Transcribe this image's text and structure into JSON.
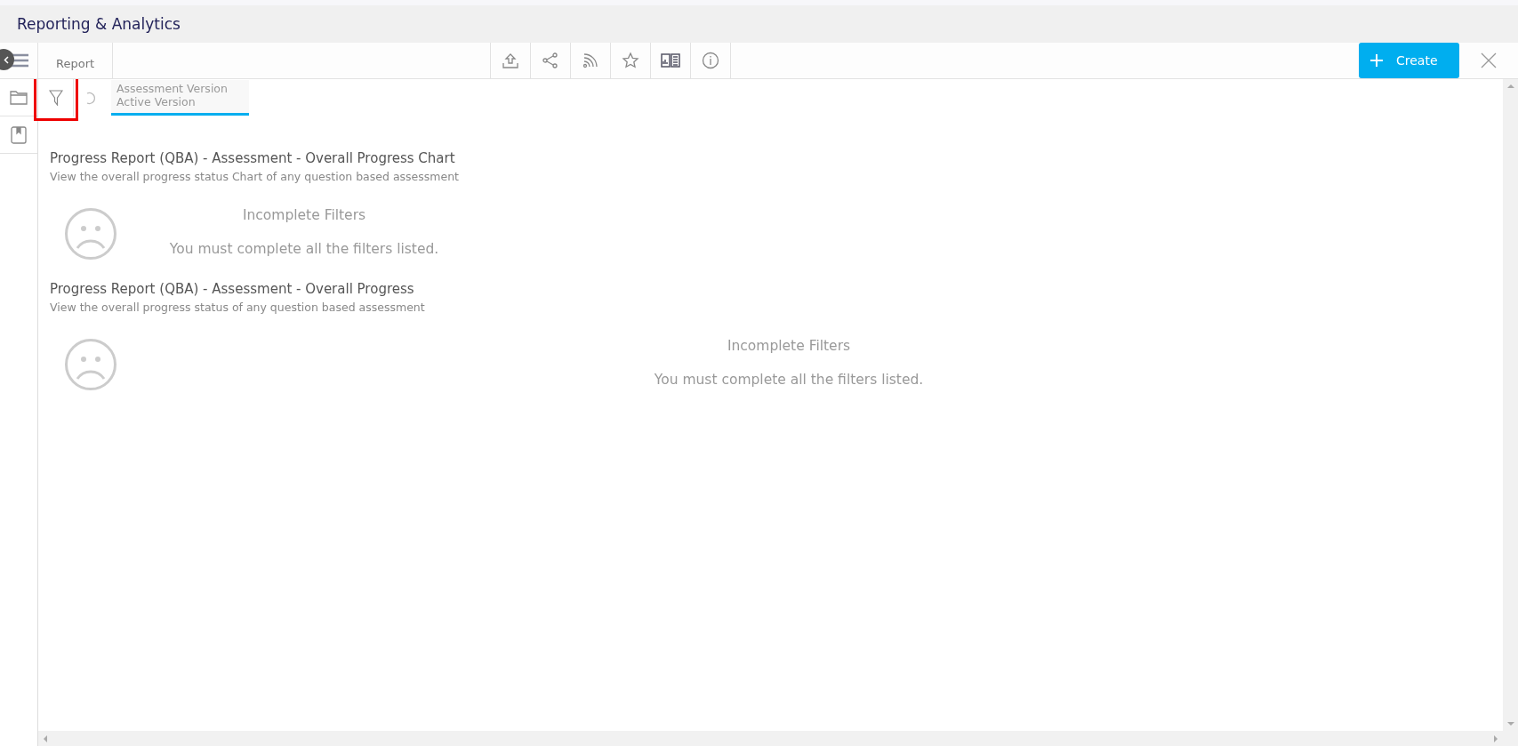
{
  "app_title": "Reporting & Analytics",
  "toolbar": {
    "tab": "Report",
    "actions": [
      {
        "kind": "upload"
      },
      {
        "kind": "share"
      },
      {
        "kind": "rss"
      },
      {
        "kind": "star"
      },
      {
        "kind": "book"
      },
      {
        "kind": "info"
      }
    ],
    "create_label": "Create"
  },
  "filter_bar": {
    "filter_highlighted": true,
    "chip": {
      "label": "Assessment Version",
      "value": "Active Version",
      "selected": true
    }
  },
  "reports": [
    {
      "title": "Progress Report (QBA) - Assessment - Overall Progress Chart",
      "description": "View the overall progress status Chart of any question based assessment",
      "message_title": "Incomplete Filters",
      "message": "You must complete all the filters listed.",
      "kind": "compact"
    },
    {
      "title": "Progress Report (QBA) - Assessment - Overall Progress",
      "description": "View the overall progress status of any question based assessment",
      "message_title": "Incomplete Filters",
      "message": "You must complete all the filters listed.",
      "kind": "full"
    }
  ]
}
